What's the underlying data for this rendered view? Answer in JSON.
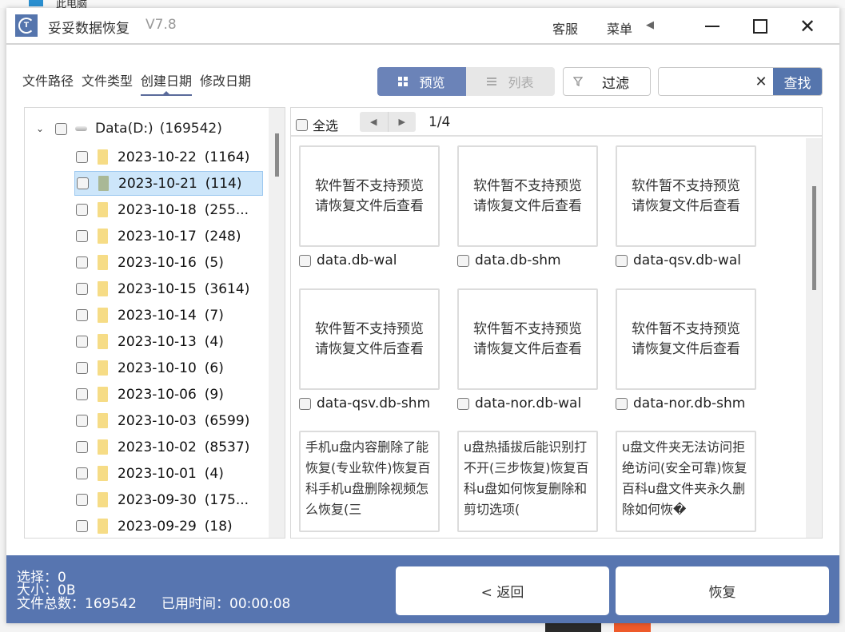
{
  "background": {
    "explorer_label": "此电脑"
  },
  "titlebar": {
    "app_name": "妥妥数据恢复",
    "version": "V7.8",
    "support_label": "客服",
    "menu_label": "菜单",
    "menu_arrow": "◀",
    "minimize_label": "",
    "maximize_label": "",
    "close_label": "✕",
    "logo_text": "T"
  },
  "tabs": [
    {
      "label": "文件路径",
      "active": false
    },
    {
      "label": "文件类型",
      "active": false
    },
    {
      "label": "创建日期",
      "active": true
    },
    {
      "label": "修改日期",
      "active": false
    }
  ],
  "view_toggle": {
    "preview_label": "预览",
    "list_label": "列表",
    "active": "preview"
  },
  "filter": {
    "label": "过滤",
    "icon": "filter-icon"
  },
  "search": {
    "value": "",
    "placeholder": "",
    "clear_label": "✕",
    "button_label": "查找"
  },
  "tree": {
    "root": {
      "label": "Data(D:)",
      "count": "(169542)",
      "expanded": true,
      "chevron": "⌄"
    },
    "items": [
      {
        "date": "2023-10-22",
        "count": "(1164)",
        "selected": false
      },
      {
        "date": "2023-10-21",
        "count": "(114)",
        "selected": true
      },
      {
        "date": "2023-10-18",
        "count": "(255...",
        "selected": false
      },
      {
        "date": "2023-10-17",
        "count": "(248)",
        "selected": false
      },
      {
        "date": "2023-10-16",
        "count": "(5)",
        "selected": false
      },
      {
        "date": "2023-10-15",
        "count": "(3614)",
        "selected": false
      },
      {
        "date": "2023-10-14",
        "count": "(7)",
        "selected": false
      },
      {
        "date": "2023-10-13",
        "count": "(4)",
        "selected": false
      },
      {
        "date": "2023-10-10",
        "count": "(6)",
        "selected": false
      },
      {
        "date": "2023-10-06",
        "count": "(9)",
        "selected": false
      },
      {
        "date": "2023-10-03",
        "count": "(6599)",
        "selected": false
      },
      {
        "date": "2023-10-02",
        "count": "(8537)",
        "selected": false
      },
      {
        "date": "2023-10-01",
        "count": "(4)",
        "selected": false
      },
      {
        "date": "2023-09-30",
        "count": "(175...",
        "selected": false
      },
      {
        "date": "2023-09-29",
        "count": "(18)",
        "selected": false
      }
    ]
  },
  "preview": {
    "select_all_label": "全选",
    "prev_icon": "◀",
    "next_icon": "▶",
    "page_indicator": "1/4",
    "files": [
      {
        "name": "data.db-wal",
        "preview": "软件暂不支持预览\n请恢复文件后查看",
        "kind": "unsupported"
      },
      {
        "name": "data.db-shm",
        "preview": "软件暂不支持预览\n请恢复文件后查看",
        "kind": "unsupported"
      },
      {
        "name": "data-qsv.db-wal",
        "preview": "软件暂不支持预览\n请恢复文件后查看",
        "kind": "unsupported"
      },
      {
        "name": "data-qsv.db-shm",
        "preview": "软件暂不支持预览\n请恢复文件后查看",
        "kind": "unsupported"
      },
      {
        "name": "data-nor.db-wal",
        "preview": "软件暂不支持预览\n请恢复文件后查看",
        "kind": "unsupported"
      },
      {
        "name": "data-nor.db-shm",
        "preview": "软件暂不支持预览\n请恢复文件后查看",
        "kind": "unsupported"
      },
      {
        "name": "",
        "preview": "手机u盘内容删除了能恢复(专业软件)恢复百科手机u盘删除视频怎么恢复(三",
        "kind": "text"
      },
      {
        "name": "",
        "preview": "u盘热插拔后能识别打不开(三步恢复)恢复百科u盘如何恢复删除和剪切选项(",
        "kind": "text"
      },
      {
        "name": "",
        "preview": "u盘文件夹无法访问拒绝访问(安全可靠)恢复百科u盘文件夹永久删除如何恢�",
        "kind": "text"
      }
    ]
  },
  "status": {
    "selected_label": "选择：0",
    "size_label": "大小：0B",
    "total_label": "文件总数：169542",
    "elapsed_label": "已用时间：00:00:08"
  },
  "actions": {
    "back_label": "< 返回",
    "recover_label": "恢复"
  },
  "colors": {
    "accent": "#5575ad",
    "bottom_bar": "#5775b0",
    "selected_row": "#cde6fa"
  }
}
